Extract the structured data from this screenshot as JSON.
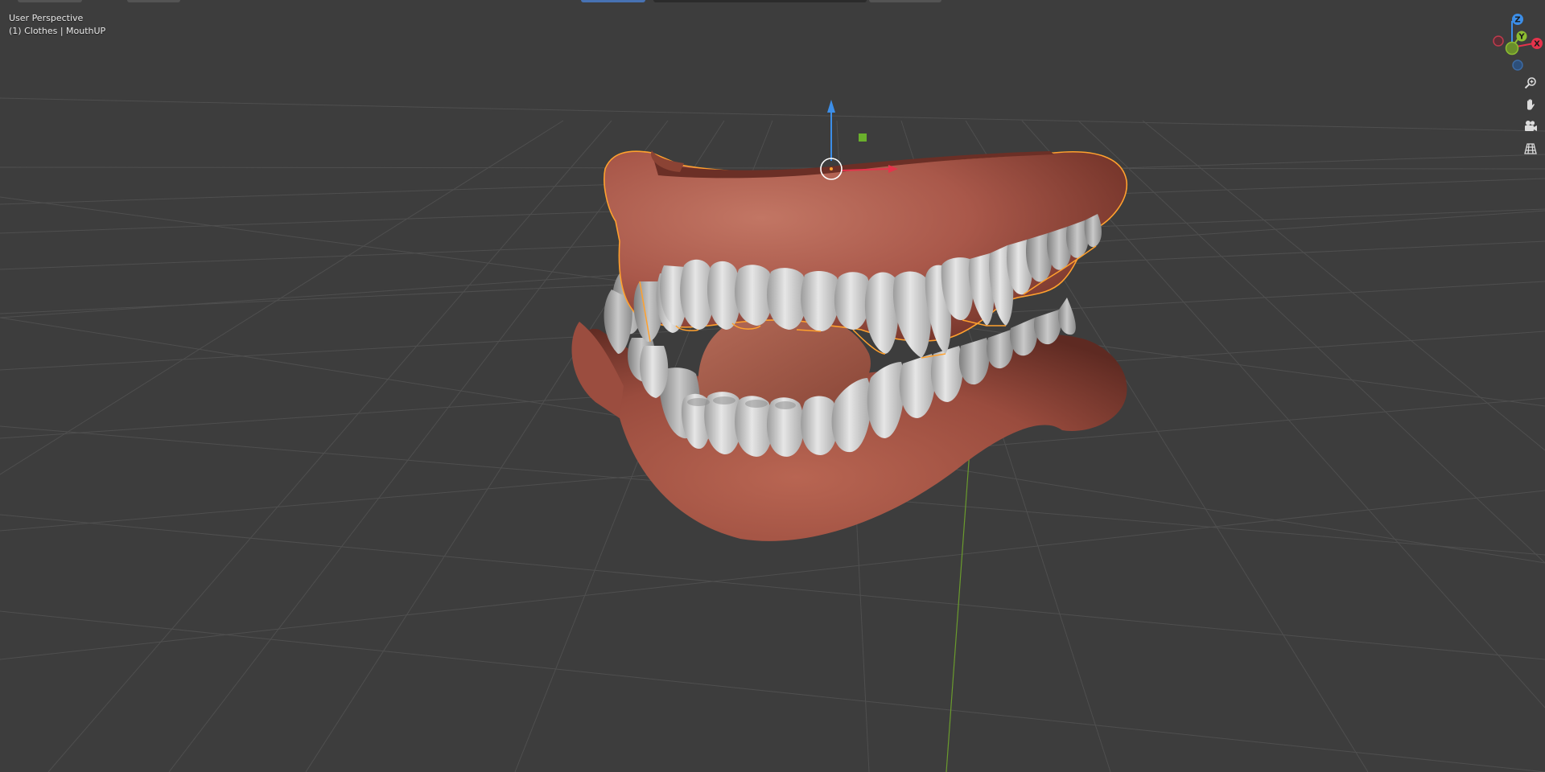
{
  "viewport": {
    "view_name": "User Perspective",
    "object_info": "(1) Clothes | MouthUP"
  },
  "gizmo": {
    "axis_x_label": "X",
    "axis_y_label": "Y",
    "axis_z_label": "Z",
    "colors": {
      "x": "#e5334b",
      "y": "#8cbd31",
      "z": "#3c8ee8",
      "selection_outline": "#ffa12e",
      "gum": "#b0604c",
      "teeth": "#d6d6d6",
      "floor_line": "#545454",
      "y_axis_line": "#6a9b2d"
    }
  },
  "nav_buttons": [
    {
      "name": "zoom-icon"
    },
    {
      "name": "pan-hand-icon"
    },
    {
      "name": "camera-icon"
    },
    {
      "name": "perspective-grid-icon"
    }
  ]
}
